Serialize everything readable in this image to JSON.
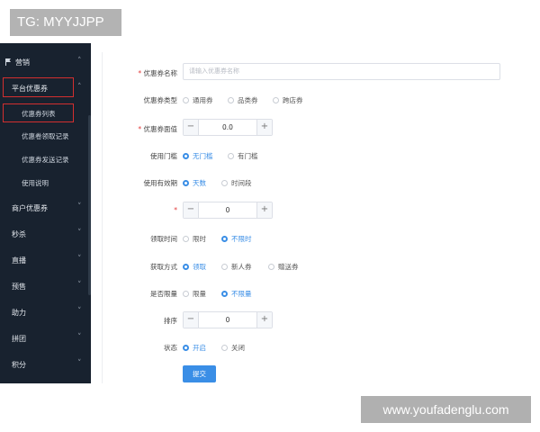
{
  "watermarks": {
    "top": "TG: MYYJJPP",
    "bottom": "www.youfadenglu.com"
  },
  "sidebar": {
    "marketing": "营销",
    "platform_coupon": "平台优惠券",
    "sub_items": [
      "优惠券列表",
      "优惠卷领取记录",
      "优惠券发送记录",
      "使用说明"
    ],
    "items": [
      "商户优惠券",
      "秒杀",
      "直播",
      "预售",
      "助力",
      "拼团",
      "积分"
    ]
  },
  "form": {
    "name_label": "优惠券名称",
    "name_placeholder": "请输入优惠券名称",
    "type_label": "优惠券类型",
    "type_options": [
      "通用券",
      "品类券",
      "跨店券"
    ],
    "value_label": "优惠券面值",
    "value": "0.0",
    "threshold_label": "使用门槛",
    "threshold_options": [
      "无门槛",
      "有门槛"
    ],
    "validity_label": "使用有效期",
    "validity_options": [
      "天数",
      "时间段"
    ],
    "days_label": "*",
    "days_value": "0",
    "claim_time_label": "领取时间",
    "claim_time_options": [
      "限时",
      "不限时"
    ],
    "method_label": "获取方式",
    "method_options": [
      "领取",
      "新人券",
      "赠送券"
    ],
    "limit_label": "是否限量",
    "limit_options": [
      "限量",
      "不限量"
    ],
    "sort_label": "排序",
    "sort_value": "0",
    "status_label": "状态",
    "status_options": [
      "开启",
      "关闭"
    ],
    "submit": "提交",
    "minus": "−",
    "plus": "+"
  },
  "colors": {
    "sidebar_bg": "#18222f",
    "accent": "#3a8ee6",
    "highlight": "#d32f2f"
  }
}
